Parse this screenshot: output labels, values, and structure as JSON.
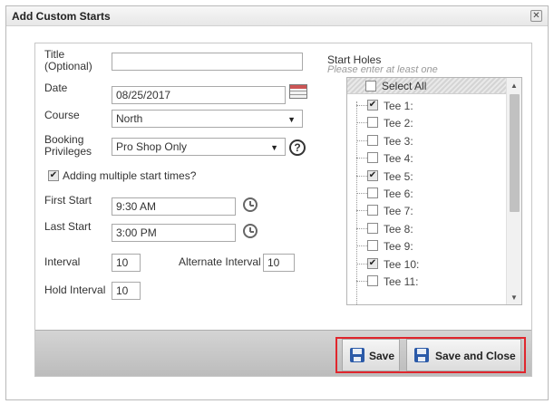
{
  "dialog": {
    "title": "Add Custom Starts",
    "close_glyph": "✕"
  },
  "form": {
    "title_label": "Title (Optional)",
    "title_value": "",
    "date_label": "Date",
    "date_value": "08/25/2017",
    "course_label": "Course",
    "course_value": "North",
    "booking_label": "Booking Privileges",
    "booking_value": "Pro Shop Only",
    "help_glyph": "?",
    "multiple_label": "Adding multiple start times?",
    "multiple_checked": true,
    "first_start_label": "First Start",
    "first_start_value": "9:30 AM",
    "last_start_label": "Last Start",
    "last_start_value": "3:00 PM",
    "interval_label": "Interval",
    "interval_value": "10",
    "alt_interval_label": "Alternate Interval",
    "alt_interval_value": "10",
    "hold_interval_label": "Hold Interval",
    "hold_interval_value": "10"
  },
  "holes": {
    "caption": "Start Holes",
    "hint": "Please enter at least one",
    "select_all_label": "Select All",
    "items": [
      {
        "label": "Tee 1:",
        "checked": true
      },
      {
        "label": "Tee 2:",
        "checked": false
      },
      {
        "label": "Tee 3:",
        "checked": false
      },
      {
        "label": "Tee 4:",
        "checked": false
      },
      {
        "label": "Tee 5:",
        "checked": true
      },
      {
        "label": "Tee 6:",
        "checked": false
      },
      {
        "label": "Tee 7:",
        "checked": false
      },
      {
        "label": "Tee 8:",
        "checked": false
      },
      {
        "label": "Tee 9:",
        "checked": false
      },
      {
        "label": "Tee 10:",
        "checked": true
      },
      {
        "label": "Tee 11:",
        "checked": false
      }
    ]
  },
  "footer": {
    "save_label": "Save",
    "save_close_label": "Save and Close",
    "highlight_color": "#e0262d"
  },
  "icons": {
    "calendar": "calendar-icon",
    "clock": "clock-icon",
    "help": "help-icon",
    "save": "floppy-disk-icon",
    "save_close": "floppy-disk-close-icon"
  }
}
